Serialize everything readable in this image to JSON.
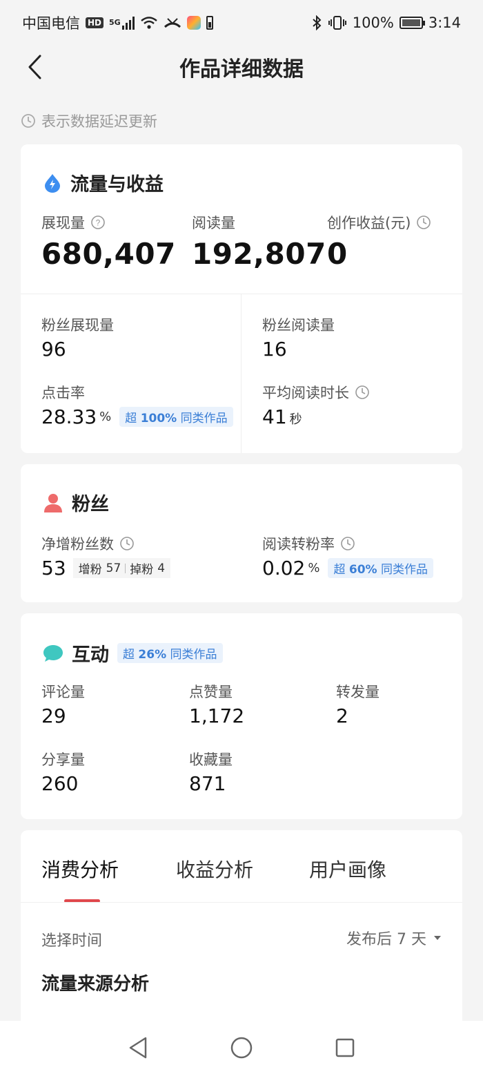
{
  "status_bar": {
    "carrier": "中国电信",
    "hd": "HD",
    "network": "5G",
    "battery": "100%",
    "time": "3:14"
  },
  "header": {
    "title": "作品详细数据"
  },
  "delay_note": "表示数据延迟更新",
  "traffic": {
    "title": "流量与收益",
    "impressions": {
      "label": "展现量",
      "value": "680,407"
    },
    "reads": {
      "label": "阅读量",
      "value": "192,807"
    },
    "earnings": {
      "label": "创作收益(元)",
      "value": "0"
    },
    "fan_impressions": {
      "label": "粉丝展现量",
      "value": "96"
    },
    "fan_reads": {
      "label": "粉丝阅读量",
      "value": "16"
    },
    "ctr": {
      "label": "点击率",
      "value": "28.33",
      "unit": "%",
      "badge_prefix": "超",
      "badge_percent": "100%",
      "badge_suffix": "同类作品"
    },
    "avg_read_time": {
      "label": "平均阅读时长",
      "value": "41",
      "unit": "秒"
    }
  },
  "fans": {
    "title": "粉丝",
    "net_gain": {
      "label": "净增粉丝数",
      "value": "53",
      "gain_label": "增粉",
      "gain_value": "57",
      "loss_label": "掉粉",
      "loss_value": "4"
    },
    "conversion": {
      "label": "阅读转粉率",
      "value": "0.02",
      "unit": "%",
      "badge_prefix": "超",
      "badge_percent": "60%",
      "badge_suffix": "同类作品"
    }
  },
  "interaction": {
    "title": "互动",
    "badge_prefix": "超",
    "badge_percent": "26%",
    "badge_suffix": "同类作品",
    "comments": {
      "label": "评论量",
      "value": "29"
    },
    "likes": {
      "label": "点赞量",
      "value": "1,172"
    },
    "reposts": {
      "label": "转发量",
      "value": "2"
    },
    "shares": {
      "label": "分享量",
      "value": "260"
    },
    "favorites": {
      "label": "收藏量",
      "value": "871"
    }
  },
  "analysis": {
    "tabs": [
      "消费分析",
      "收益分析",
      "用户画像"
    ],
    "active_tab": 0,
    "time_label": "选择时间",
    "time_value": "发布后 7 天",
    "section_title": "流量来源分析"
  },
  "colors": {
    "accent_red": "#e0474c",
    "badge_blue": "#3b7fd6",
    "icon_blue": "#3d8ef0",
    "icon_red": "#ee6b6b",
    "icon_teal": "#3fc7c0"
  }
}
